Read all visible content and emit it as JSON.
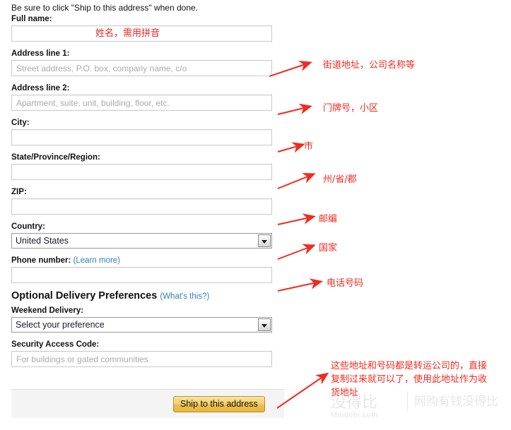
{
  "form": {
    "intro": "Be sure to click \"Ship to this address\" when done.",
    "fields": {
      "full_name": {
        "label": "Full name:",
        "value": "",
        "placeholder": "",
        "overlay_note": "姓名，需用拼音"
      },
      "address1": {
        "label": "Address line 1:",
        "value": "",
        "placeholder": "Street address, P.O. box, company name, c/o"
      },
      "address2": {
        "label": "Address line 2:",
        "value": "",
        "placeholder": "Apartment, suite, unit, building, floor, etc."
      },
      "city": {
        "label": "City:",
        "value": "",
        "placeholder": ""
      },
      "state": {
        "label": "State/Province/Region:",
        "value": "",
        "placeholder": ""
      },
      "zip": {
        "label": "ZIP:",
        "value": "",
        "placeholder": ""
      },
      "country": {
        "label": "Country:",
        "selected": "United States",
        "options": [
          "United States"
        ]
      },
      "phone": {
        "label": "Phone number:",
        "learn_more": "(Learn more)",
        "value": "",
        "placeholder": ""
      },
      "weekend_delivery": {
        "label": "Weekend Delivery:",
        "selected": "Select your preference",
        "options": [
          "Select your preference"
        ]
      },
      "security_code": {
        "label": "Security Access Code:",
        "value": "",
        "placeholder": "For buildings or gated communities"
      }
    },
    "optional_section": {
      "heading": "Optional Delivery Preferences",
      "whats_this": "(What's this?)"
    },
    "submit_label": "Ship to this address"
  },
  "annotations": {
    "address1": "街道地址，公司名称等",
    "address2": "门牌号，小区",
    "city": "市",
    "state": "州/省/郡",
    "zip": "邮编",
    "country": "国家",
    "phone": "电话号码",
    "submit_note": "这些地址和号码都是转运公司的，直接复制过来就可以了，使用此地址作为收货地址"
  },
  "watermark": {
    "cn_primary": "没得比",
    "cn_secondary": "网购有钱没得比",
    "url": "Meidebi.com"
  },
  "colors": {
    "annotation_red": "#f22a20",
    "link_blue": "#2f7fbf",
    "button_gold": "#edbe4a",
    "footer_gray": "#f4f4f4",
    "input_border": "#c9c9c9"
  }
}
